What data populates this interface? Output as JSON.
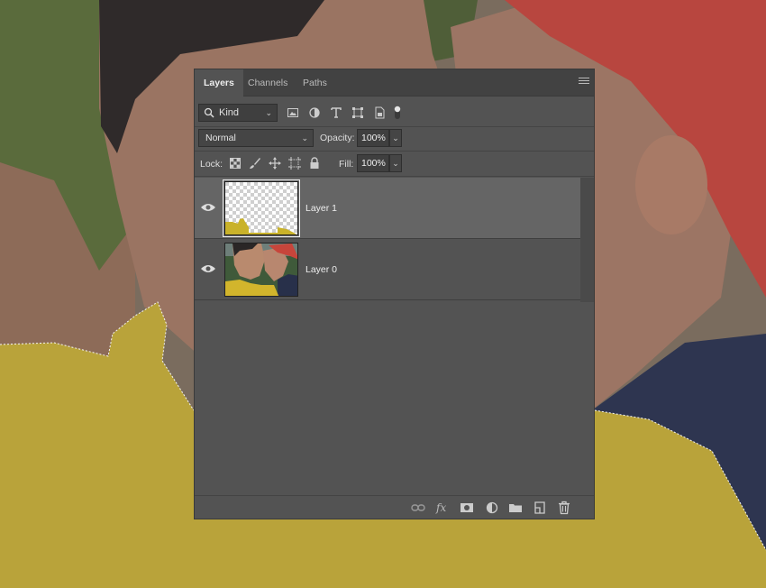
{
  "panel": {
    "tabs": [
      {
        "label": "Layers",
        "active": true
      },
      {
        "label": "Channels",
        "active": false
      },
      {
        "label": "Paths",
        "active": false
      }
    ]
  },
  "filter": {
    "kind_label": "Kind",
    "icons": [
      "pixel-filter-icon",
      "adjustment-filter-icon",
      "type-filter-icon",
      "shape-filter-icon",
      "smart-object-filter-icon",
      "filter-toggle-icon"
    ]
  },
  "blend": {
    "mode": "Normal",
    "opacity_label": "Opacity:",
    "opacity_value": "100%"
  },
  "lock": {
    "label": "Lock:",
    "icons": [
      "lock-transparent-pixels-icon",
      "lock-image-pixels-icon",
      "lock-position-icon",
      "artboard-nesting-icon",
      "lock-all-icon"
    ],
    "fill_label": "Fill:",
    "fill_value": "100%"
  },
  "layers": [
    {
      "name": "Layer 1",
      "visible": true,
      "selected": true,
      "thumbnail": "transparent-with-yellow-jacket"
    },
    {
      "name": "Layer 0",
      "visible": true,
      "selected": false,
      "thumbnail": "photo-couple"
    }
  ],
  "footer_icons": [
    "link-layers-icon",
    "layer-style-fx-icon",
    "add-mask-icon",
    "adjustment-layer-icon",
    "new-group-folder-icon",
    "new-layer-icon",
    "delete-trash-icon"
  ],
  "colors": {
    "panel_bg": "#535353",
    "selected_layer": "#656565",
    "yellow_jacket": "#c9b22a",
    "red_cap": "#c4433b"
  }
}
